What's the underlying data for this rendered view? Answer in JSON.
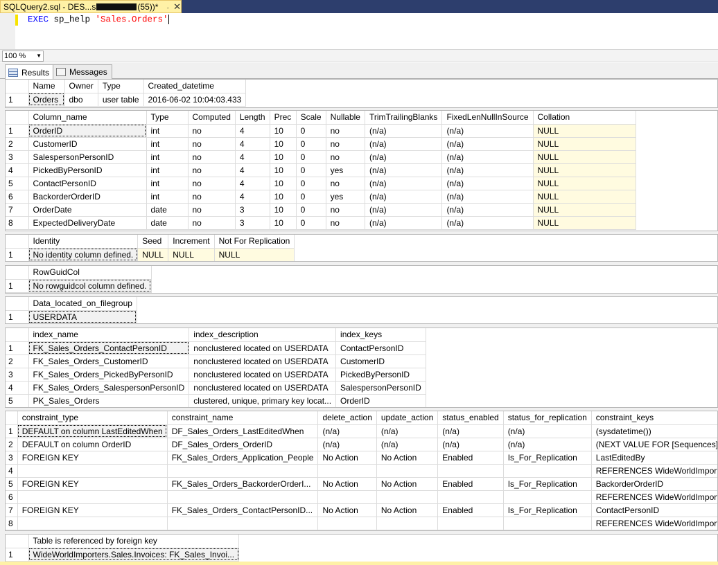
{
  "window": {
    "tab_title_prefix": "SQLQuery2.sql - DES...s ",
    "tab_title_suffix": "(55))*",
    "pin_icon": "pin-icon",
    "close_icon": "close-icon"
  },
  "editor": {
    "exec_kw": "EXEC",
    "proc": " sp_help ",
    "arg": "'Sales.Orders'"
  },
  "zoom": {
    "value": "100 %"
  },
  "result_tabs": {
    "results": "Results",
    "messages": "Messages"
  },
  "panes": [
    {
      "id": "table-info",
      "columns": [
        "Name",
        "Owner",
        "Type",
        "Created_datetime"
      ],
      "widths": [
        52,
        48,
        60,
        136
      ],
      "rows": [
        [
          "Orders",
          "dbo",
          "user table",
          "2016-06-02 10:04:03.433"
        ]
      ],
      "null_cols": [],
      "selected": [
        0,
        0
      ]
    },
    {
      "id": "columns-info",
      "columns": [
        "Column_name",
        "Type",
        "Computed",
        "Length",
        "Prec",
        "Scale",
        "Nullable",
        "TrimTrailingBlanks",
        "FixedLenNullInSource",
        "Collation"
      ],
      "widths": [
        170,
        60,
        64,
        48,
        38,
        42,
        54,
        102,
        120,
        148
      ],
      "rows": [
        [
          "OrderID",
          "int",
          "no",
          "4",
          "10",
          "0",
          "no",
          "(n/a)",
          "(n/a)",
          "NULL"
        ],
        [
          "CustomerID",
          "int",
          "no",
          "4",
          "10",
          "0",
          "no",
          "(n/a)",
          "(n/a)",
          "NULL"
        ],
        [
          "SalespersonPersonID",
          "int",
          "no",
          "4",
          "10",
          "0",
          "no",
          "(n/a)",
          "(n/a)",
          "NULL"
        ],
        [
          "PickedByPersonID",
          "int",
          "no",
          "4",
          "10",
          "0",
          "yes",
          "(n/a)",
          "(n/a)",
          "NULL"
        ],
        [
          "ContactPersonID",
          "int",
          "no",
          "4",
          "10",
          "0",
          "no",
          "(n/a)",
          "(n/a)",
          "NULL"
        ],
        [
          "BackorderOrderID",
          "int",
          "no",
          "4",
          "10",
          "0",
          "yes",
          "(n/a)",
          "(n/a)",
          "NULL"
        ],
        [
          "OrderDate",
          "date",
          "no",
          "3",
          "10",
          "0",
          "no",
          "(n/a)",
          "(n/a)",
          "NULL"
        ],
        [
          "ExpectedDeliveryDate",
          "date",
          "no",
          "3",
          "10",
          "0",
          "no",
          "(n/a)",
          "(n/a)",
          "NULL"
        ]
      ],
      "null_cols": [
        9
      ],
      "selected": [
        0,
        0
      ]
    },
    {
      "id": "identity-info",
      "columns": [
        "Identity",
        "Seed",
        "Increment",
        "Not For Replication"
      ],
      "widths": [
        146,
        44,
        62,
        104
      ],
      "rows": [
        [
          "No identity column defined.",
          "NULL",
          "NULL",
          "NULL"
        ]
      ],
      "null_cols": [
        1,
        2,
        3
      ],
      "selected": [
        0,
        0
      ]
    },
    {
      "id": "rowguid-info",
      "columns": [
        "RowGuidCol"
      ],
      "widths": [
        164
      ],
      "rows": [
        [
          "No rowguidcol column defined."
        ]
      ],
      "null_cols": [],
      "selected": [
        0,
        0
      ]
    },
    {
      "id": "filegroup-info",
      "columns": [
        "Data_located_on_filegroup"
      ],
      "widths": [
        144
      ],
      "rows": [
        [
          "USERDATA"
        ]
      ],
      "null_cols": [],
      "selected": [
        0,
        0
      ]
    },
    {
      "id": "index-info",
      "columns": [
        "index_name",
        "index_description",
        "index_keys"
      ],
      "widths": [
        206,
        192,
        118
      ],
      "rows": [
        [
          "FK_Sales_Orders_ContactPersonID",
          "nonclustered located on USERDATA",
          "ContactPersonID"
        ],
        [
          "FK_Sales_Orders_CustomerID",
          "nonclustered located on USERDATA",
          "CustomerID"
        ],
        [
          "FK_Sales_Orders_PickedByPersonID",
          "nonclustered located on USERDATA",
          "PickedByPersonID"
        ],
        [
          "FK_Sales_Orders_SalespersonPersonID",
          "nonclustered located on USERDATA",
          "SalespersonPersonID"
        ],
        [
          "PK_Sales_Orders",
          "clustered, unique, primary key locat...",
          "OrderID"
        ]
      ],
      "null_cols": [],
      "selected": [
        0,
        0
      ]
    },
    {
      "id": "constraint-info",
      "columns": [
        "constraint_type",
        "constraint_name",
        "delete_action",
        "update_action",
        "status_enabled",
        "status_for_replication",
        "constraint_keys"
      ],
      "widths": [
        200,
        194,
        80,
        84,
        88,
        116,
        224
      ],
      "rows": [
        [
          "DEFAULT on column LastEditedWhen",
          "DF_Sales_Orders_LastEditedWhen",
          "(n/a)",
          "(n/a)",
          "(n/a)",
          "(n/a)",
          "(sysdatetime())"
        ],
        [
          "DEFAULT on column OrderID",
          "DF_Sales_Orders_OrderID",
          "(n/a)",
          "(n/a)",
          "(n/a)",
          "(n/a)",
          "(NEXT VALUE FOR [Sequences].[OrderID])"
        ],
        [
          "FOREIGN KEY",
          "FK_Sales_Orders_Application_People",
          "No Action",
          "No Action",
          "Enabled",
          "Is_For_Replication",
          "LastEditedBy"
        ],
        [
          "",
          "",
          "",
          "",
          "",
          "",
          "REFERENCES WideWorldImporters.Appli..."
        ],
        [
          "FOREIGN KEY",
          "FK_Sales_Orders_BackorderOrderI...",
          "No Action",
          "No Action",
          "Enabled",
          "Is_For_Replication",
          "BackorderOrderID"
        ],
        [
          "",
          "",
          "",
          "",
          "",
          "",
          "REFERENCES WideWorldImporters.Sale..."
        ],
        [
          "FOREIGN KEY",
          "FK_Sales_Orders_ContactPersonID...",
          "No Action",
          "No Action",
          "Enabled",
          "Is_For_Replication",
          "ContactPersonID"
        ],
        [
          "",
          "",
          "",
          "",
          "",
          "",
          "REFERENCES WideWorldImporters.Appli..."
        ]
      ],
      "null_cols": [],
      "selected": [
        0,
        0
      ]
    },
    {
      "id": "referenced-by-info",
      "columns": [
        "Table is referenced by foreign key"
      ],
      "widths": [
        276
      ],
      "rows": [
        [
          "WideWorldImporters.Sales.Invoices: FK_Sales_Invoi..."
        ]
      ],
      "null_cols": [],
      "selected": [
        0,
        0
      ]
    }
  ]
}
